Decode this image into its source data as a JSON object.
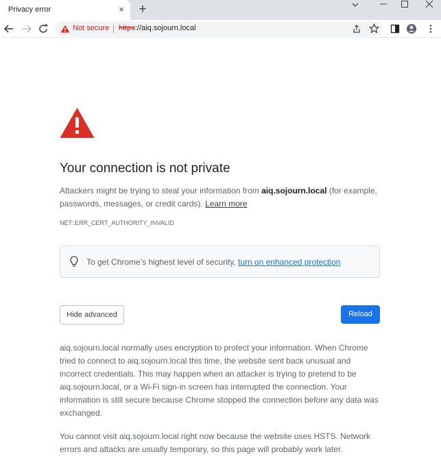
{
  "tab": {
    "title": "Privacy error",
    "close_glyph": "×",
    "new_tab_glyph": "+"
  },
  "window_controls": {
    "chevron": "⌄",
    "minimize": "—",
    "maximize": "☐",
    "close": "✕"
  },
  "omnibox": {
    "security_label": "Not secure",
    "url_scheme": "https",
    "url_rest": "://aiq.sojourn.local"
  },
  "colors": {
    "warning_red": "#d93025",
    "link_blue": "#1a73e8",
    "reload_button": "#1a73e8"
  },
  "interstitial": {
    "heading": "Your connection is not private",
    "explain_before": "Attackers might be trying to steal your information from ",
    "explain_host": "aiq.sojourn.local",
    "explain_after": " (for example, passwords, messages, or credit cards). ",
    "learn_more": "Learn more",
    "error_code": "NET::ERR_CERT_AUTHORITY_INVALID",
    "enhanced_text": "To get Chrome’s highest level of security, ",
    "enhanced_link": "turn on enhanced protection",
    "hide_advanced_label": "Hide advanced",
    "reload_label": "Reload",
    "details_1": "aiq.sojourn.local normally uses encryption to protect your information. When Chrome tried to connect to aiq.sojourn.local this time, the website sent back unusual and incorrect credentials. This may happen when an attacker is trying to pretend to be aiq.sojourn.local, or a Wi-Fi sign-in screen has interrupted the connection. Your information is still secure because Chrome stopped the connection before any data was exchanged.",
    "details_2": "You cannot visit aiq.sojourn.local right now because the website uses HSTS. Network errors and attacks are usually temporary, so this page will probably work later."
  }
}
